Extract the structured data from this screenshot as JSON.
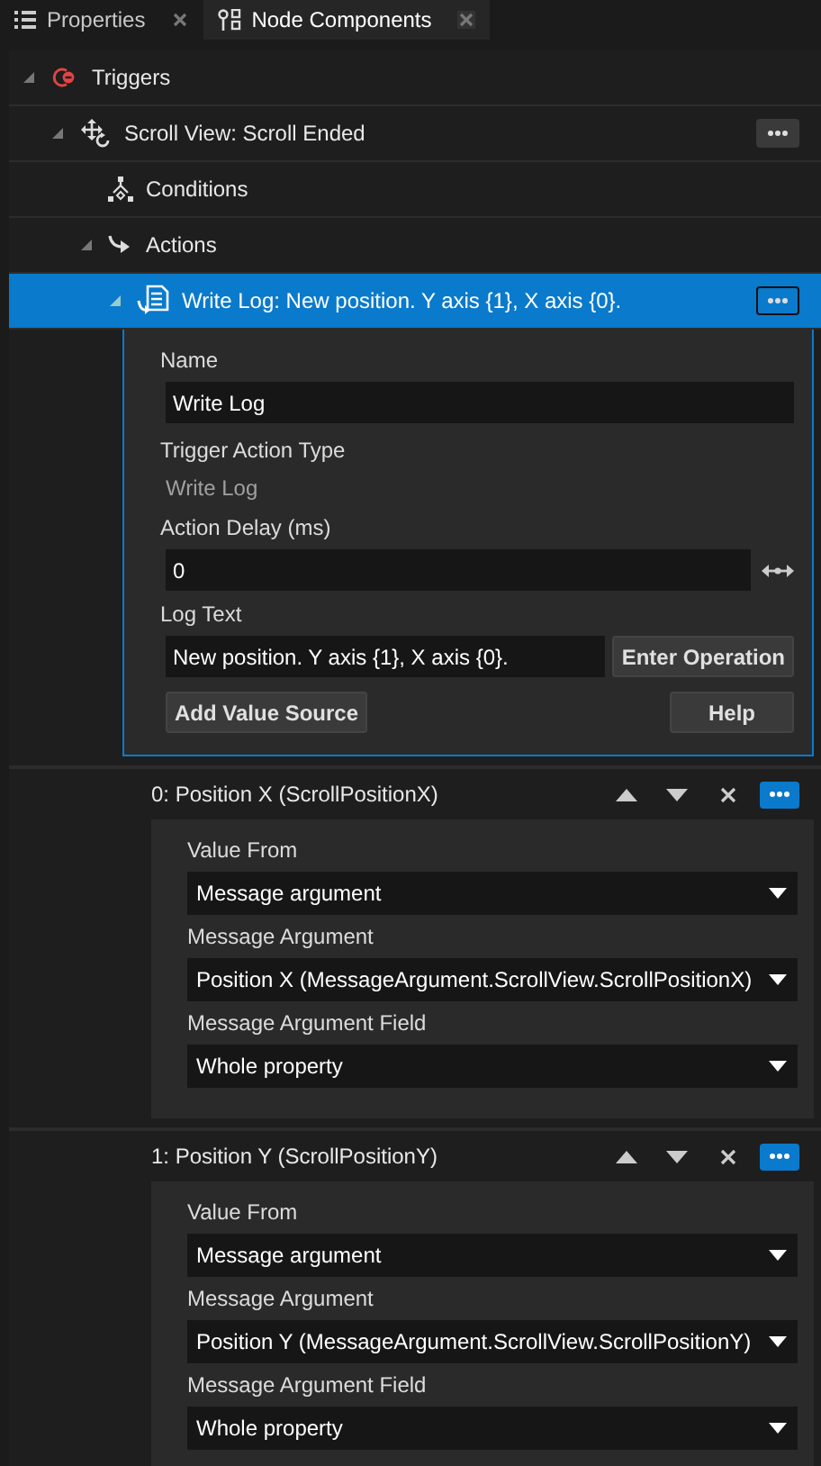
{
  "tabs": [
    {
      "label": "Properties",
      "selected": false,
      "kind": "properties"
    },
    {
      "label": "Node Components",
      "selected": true,
      "kind": "components"
    }
  ],
  "tree": [
    {
      "label": "Triggers",
      "kind": "trigger",
      "expanded": true,
      "selected": false,
      "menu": false,
      "children": [
        {
          "label": "Scroll View: Scroll Ended",
          "kind": "event",
          "expanded": true,
          "selected": false,
          "menu": true,
          "children": [
            {
              "label": "Conditions",
              "kind": "conditions",
              "selected": false,
              "menu": false
            },
            {
              "label": "Actions",
              "kind": "actions",
              "expanded": true,
              "selected": false,
              "menu": false,
              "children": [
                {
                  "label": "Write Log: New position. Y axis {1}, X axis {0}.",
                  "kind": "log",
                  "expanded": true,
                  "selected": true,
                  "menu": true
                }
              ]
            }
          ]
        }
      ]
    }
  ],
  "action_details": {
    "fields": [
      {
        "kind": "text",
        "label": "Name",
        "value": "Write Log"
      },
      {
        "kind": "readonly",
        "label": "Trigger Action Type",
        "value": "Write Log"
      },
      {
        "kind": "number",
        "label": "Action Delay (ms)",
        "value": "0"
      },
      {
        "kind": "text-button",
        "label": "Log Text",
        "value": "New position. Y axis {1}, X axis {0}.",
        "button": "Enter Operation"
      }
    ],
    "buttons": [
      "Add Value Source",
      "Help"
    ]
  },
  "value_sources": [
    {
      "title": "0: Position X (ScrollPositionX)",
      "fields": [
        {
          "label": "Value From",
          "value": "Message argument"
        },
        {
          "label": "Message Argument",
          "value": "Position X (MessageArgument.ScrollView.ScrollPositionX)"
        },
        {
          "label": "Message Argument Field",
          "value": "Whole property"
        }
      ]
    },
    {
      "title": "1: Position Y (ScrollPositionY)",
      "fields": [
        {
          "label": "Value From",
          "value": "Message argument"
        },
        {
          "label": "Message Argument",
          "value": "Position Y (MessageArgument.ScrollView.ScrollPositionY)"
        },
        {
          "label": "Message Argument Field",
          "value": "Whole property"
        }
      ]
    }
  ]
}
